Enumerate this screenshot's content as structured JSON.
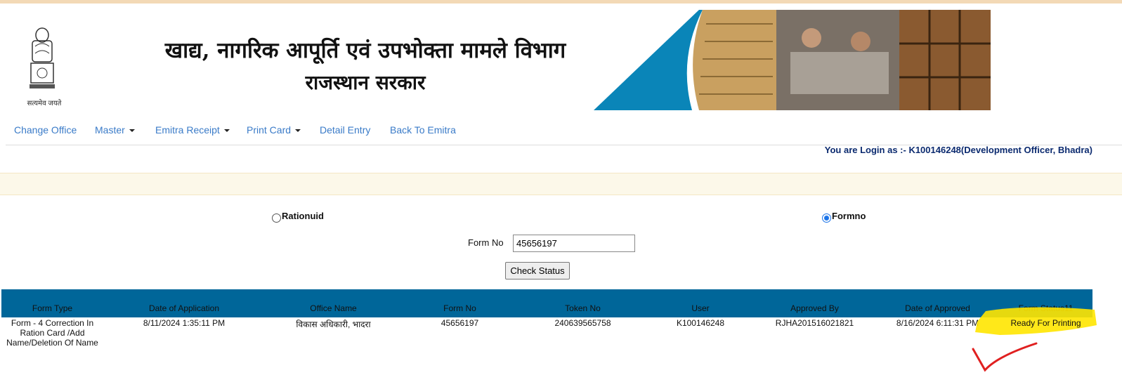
{
  "header": {
    "title_line1": "खाद्य, नागरिक आपूर्ति एवं उपभोक्ता मामले विभाग",
    "title_line2": "राजस्थान सरकार",
    "emblem_motto": "सत्यमेव जयते"
  },
  "nav": {
    "items": [
      {
        "label": "Change Office",
        "dropdown": false
      },
      {
        "label": "Master",
        "dropdown": true
      },
      {
        "label": "Emitra Receipt",
        "dropdown": true
      },
      {
        "label": "Print Card",
        "dropdown": true
      },
      {
        "label": "Detail Entry",
        "dropdown": false
      },
      {
        "label": "Back To Emitra",
        "dropdown": false
      }
    ]
  },
  "login_text": "You are Login as :- K100146248(Development Officer, Bhadra)",
  "search": {
    "radio_rationuid": "Rationuid",
    "radio_formno": "Formno",
    "selected": "Formno",
    "form_no_label": "Form No",
    "form_no_value": "45656197",
    "check_button": "Check Status"
  },
  "table": {
    "headers": [
      "Form Type",
      "Date of Application",
      "Office Name",
      "Form No",
      "Token No",
      "User",
      "Approved By",
      "Date of Approved",
      "Form Status11"
    ],
    "rows": [
      [
        "Form - 4 Correction In Ration Card /Add Name/Deletion Of Name",
        "8/11/2024 1:35:11 PM",
        "विकास अधिकारी, भादरा",
        "45656197",
        "240639565758",
        "K100146248",
        "RJHA201516021821",
        "8/16/2024 6:11:31 PM",
        "Ready For Printing"
      ]
    ]
  },
  "colors": {
    "table_header": "#006699",
    "nav_link": "#3a7bc8",
    "highlight": "#ffe600",
    "checkmark": "#e02020"
  }
}
